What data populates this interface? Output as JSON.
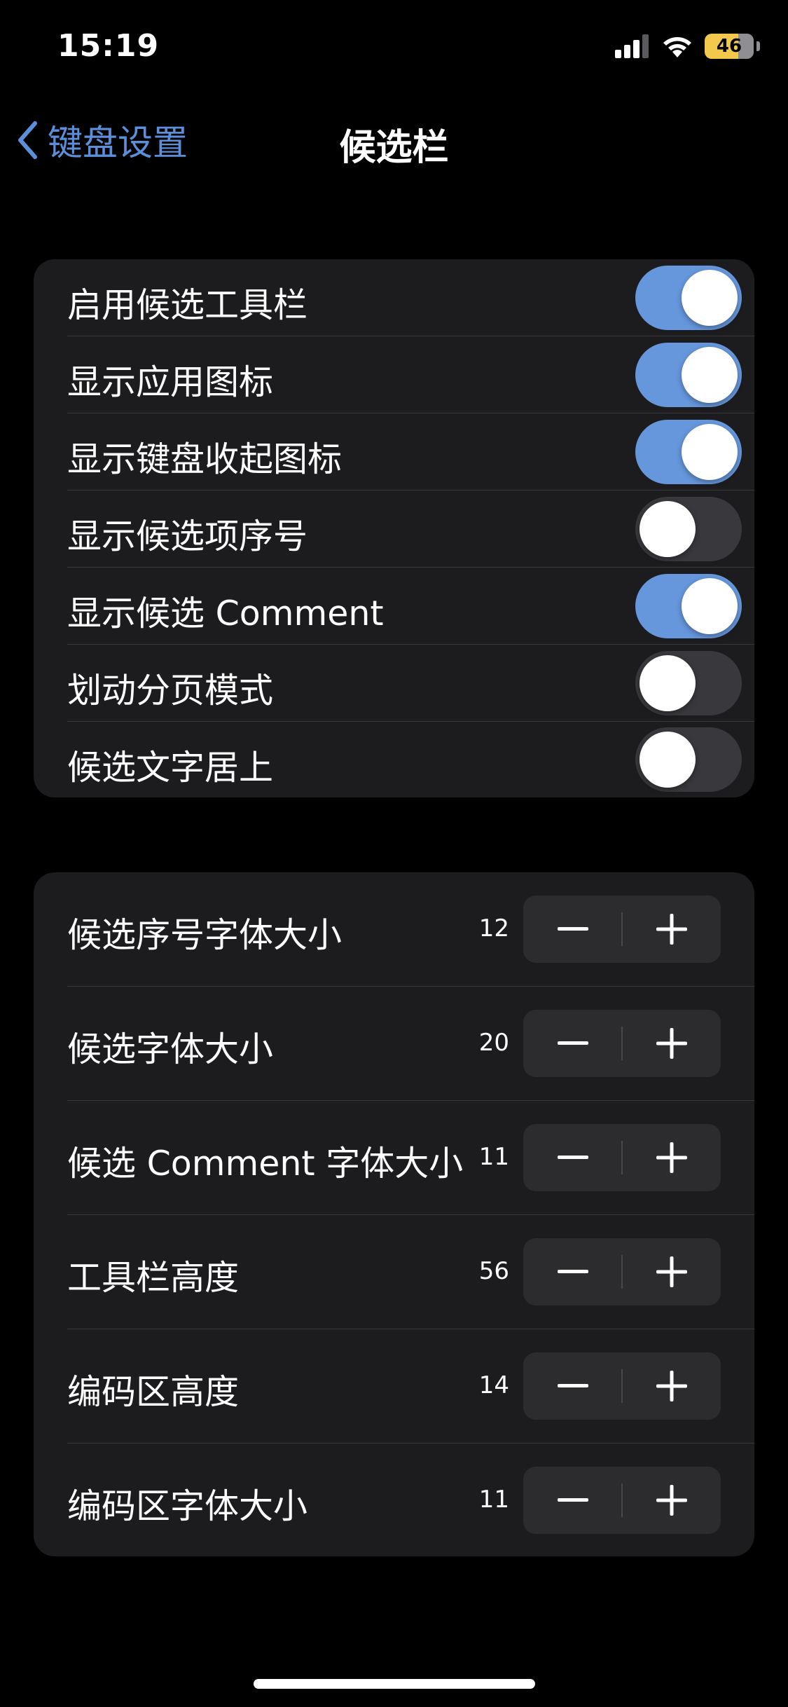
{
  "status_bar": {
    "time": "15:19",
    "battery_level": "46",
    "icons": [
      "cellular-signal-icon",
      "wifi-icon",
      "battery-icon"
    ]
  },
  "nav": {
    "back_label": "键盘设置",
    "title": "候选栏",
    "back_icon": "chevron-left-icon"
  },
  "toggles": [
    {
      "label": "启用候选工具栏",
      "on": true
    },
    {
      "label": "显示应用图标",
      "on": true
    },
    {
      "label": "显示键盘收起图标",
      "on": true
    },
    {
      "label": "显示候选项序号",
      "on": false
    },
    {
      "label": "显示候选 Comment",
      "on": true
    },
    {
      "label": "划动分页模式",
      "on": false
    },
    {
      "label": "候选文字居上",
      "on": false
    }
  ],
  "steppers": [
    {
      "label": "候选序号字体大小",
      "value": "12"
    },
    {
      "label": "候选字体大小",
      "value": "20"
    },
    {
      "label": "候选 Comment 字体大小",
      "value": "11"
    },
    {
      "label": "工具栏高度",
      "value": "56"
    },
    {
      "label": "编码区高度",
      "value": "14"
    },
    {
      "label": "编码区字体大小",
      "value": "11"
    }
  ],
  "colors": {
    "accent": "#5b8fd9",
    "toggle_on": "#6697dc",
    "toggle_off": "#39393d",
    "group_bg": "#1c1c1e",
    "background": "#000000",
    "battery": "#f2c94c"
  }
}
